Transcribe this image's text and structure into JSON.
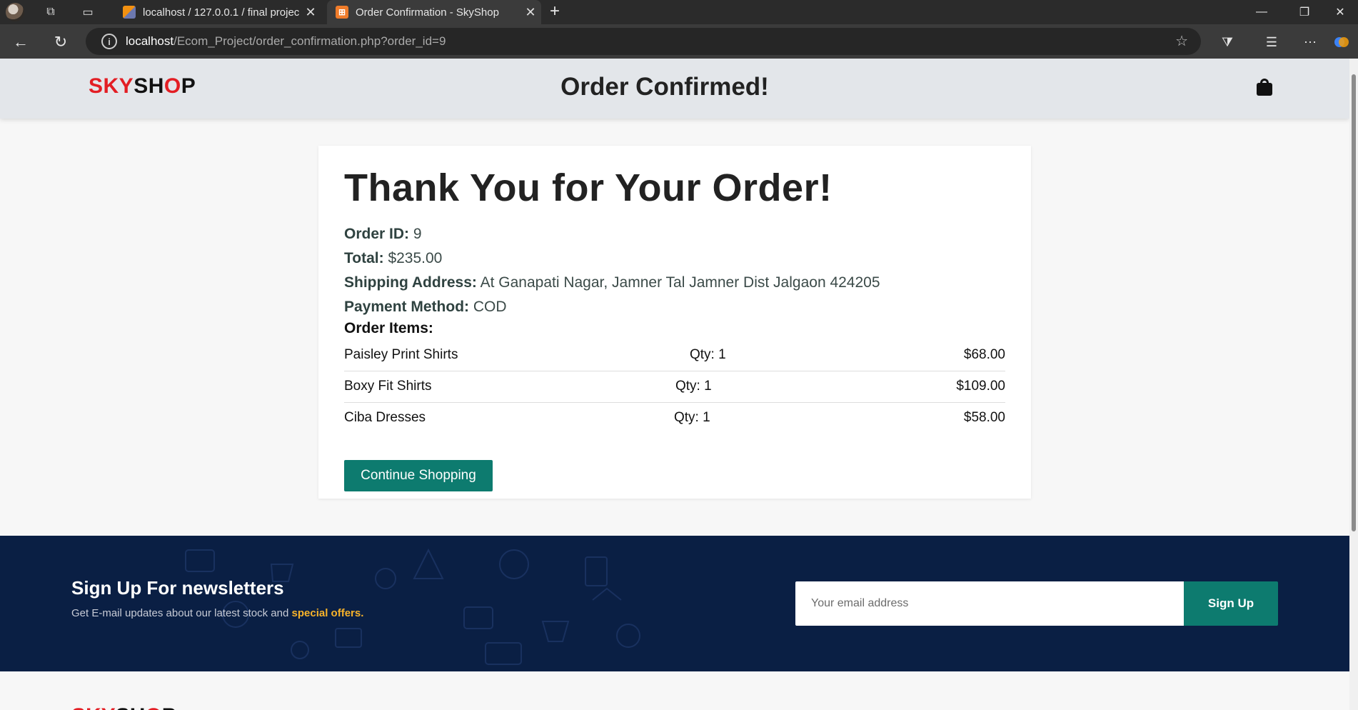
{
  "browser": {
    "tabs": [
      {
        "title": "localhost / 127.0.0.1 / final projec",
        "close": "✕"
      },
      {
        "title": "Order Confirmation - SkyShop",
        "close": "✕"
      }
    ],
    "url_host": "localhost",
    "url_path": "/Ecom_Project/order_confirmation.php?order_id=9"
  },
  "header": {
    "logo_red": "SKY",
    "logo_dark": "SH",
    "logo_o": "O",
    "logo_p": "P",
    "title": "Order Confirmed!"
  },
  "order": {
    "heading": "Thank You for Your Order!",
    "id_label": "Order ID:",
    "id_value": "9",
    "total_label": "Total:",
    "total_value": "$235.00",
    "address_label": "Shipping Address:",
    "address_value": "At Ganapati Nagar, Jamner Tal Jamner Dist Jalgaon 424205",
    "payment_label": "Payment Method:",
    "payment_value": "COD",
    "items_label": "Order Items:",
    "items": [
      {
        "name": "Paisley Print Shirts",
        "qty": "Qty: 1",
        "price": "$68.00"
      },
      {
        "name": "Boxy Fit Shirts",
        "qty": "Qty: 1",
        "price": "$109.00"
      },
      {
        "name": "Ciba Dresses",
        "qty": "Qty: 1",
        "price": "$58.00"
      }
    ],
    "continue_label": "Continue Shopping"
  },
  "newsletter": {
    "title": "Sign Up For newsletters",
    "subtitle": "Get E-mail updates about our latest stock and",
    "subtitle_highlight": "special offers.",
    "placeholder": "Your email address",
    "button": "Sign Up"
  },
  "colors": {
    "brand_red": "#e31e24",
    "accent_teal": "#0d7b6f",
    "newsletter_bg": "#0a1f44",
    "highlight_yellow": "#f8b32a"
  }
}
